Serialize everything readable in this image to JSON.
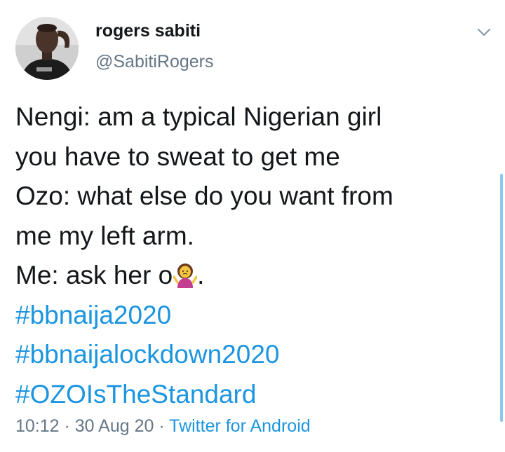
{
  "user": {
    "display_name": "rogers sabiti",
    "handle": "@SabitiRogers"
  },
  "tweet": {
    "lines": [
      "Nengi: am a typical Nigerian girl",
      "you have to sweat to get me",
      "Ozo: what else do you want from",
      "me my left arm.",
      "Me: ask her o",
      "."
    ],
    "hashtags": [
      "#bbnaija2020",
      "#bbnaijalockdown2020",
      "#OZOIsTheStandard"
    ],
    "emoji": "woman-shrugging-icon"
  },
  "meta": {
    "time": "10:12",
    "separator": " · ",
    "date": "30 Aug 20",
    "source": "Twitter for Android"
  },
  "colors": {
    "text": "#14171a",
    "secondary": "#657786",
    "link": "#1b95e0"
  }
}
